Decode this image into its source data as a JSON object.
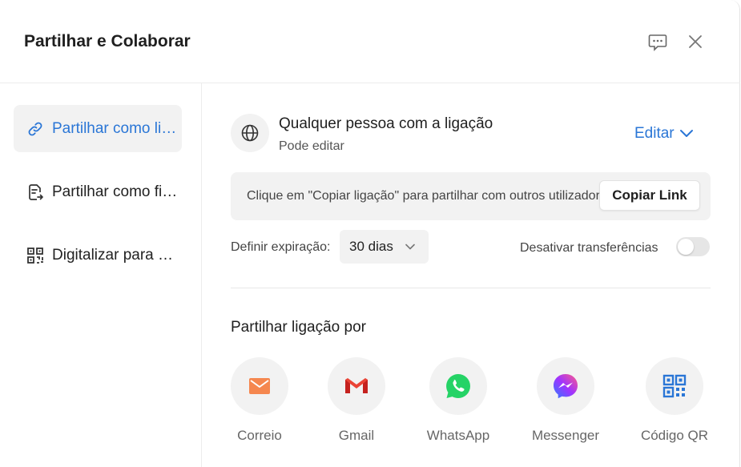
{
  "dialog": {
    "title": "Partilhar e Colaborar"
  },
  "header": {
    "feedback_icon": "feedback-icon",
    "close_icon": "close-icon"
  },
  "sidebar": {
    "items": [
      {
        "label": "Partilhar como ligação",
        "icon": "link-icon",
        "active": true
      },
      {
        "label": "Partilhar como ficheiro",
        "icon": "file-share-icon",
        "active": false
      },
      {
        "label": "Digitalizar para partilhar",
        "icon": "qr-code-icon",
        "active": false
      }
    ]
  },
  "access": {
    "title": "Qualquer pessoa com a ligação",
    "subtitle": "Pode editar",
    "edit_label": "Editar"
  },
  "link": {
    "hint": "Clique em \"Copiar ligação\" para partilhar com outros utilizadores",
    "copy_label": "Copiar Link"
  },
  "expiration": {
    "label": "Definir expiração:",
    "value": "30 dias"
  },
  "downloads": {
    "label": "Desativar transferências",
    "enabled": false
  },
  "share_via": {
    "title": "Partilhar ligação por",
    "options": [
      {
        "label": "Correio",
        "icon": "mail-icon"
      },
      {
        "label": "Gmail",
        "icon": "gmail-icon"
      },
      {
        "label": "WhatsApp",
        "icon": "whatsapp-icon"
      },
      {
        "label": "Messenger",
        "icon": "messenger-icon"
      },
      {
        "label": "Código QR",
        "icon": "qr-code-icon"
      }
    ]
  },
  "colors": {
    "accent": "#2a76d6",
    "mail": "#f5874f",
    "gmail_red": "#ea4335",
    "whatsapp": "#25d366",
    "messenger": "#a033ff",
    "qr": "#2a76d6"
  }
}
